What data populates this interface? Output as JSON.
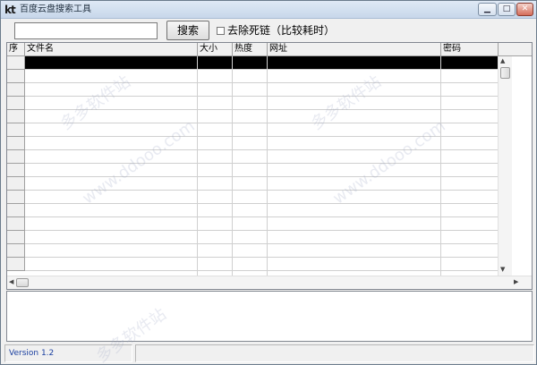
{
  "window": {
    "title": "百度云盘搜索工具",
    "icon": "kt",
    "controls": {
      "minimize_icon": "minimize-icon",
      "maximize_icon": "maximize-icon",
      "close_icon": "close-icon"
    }
  },
  "search": {
    "input_value": "",
    "button_label": "搜索",
    "checkbox_label": "去除死链（比较耗时）",
    "checkbox_checked": false
  },
  "table": {
    "columns": [
      "序",
      "文件名",
      "大小",
      "热度",
      "网址",
      "密码"
    ],
    "row_count": 16,
    "selected_row": 0
  },
  "status": {
    "version": "Version 1.2",
    "message": ""
  },
  "watermarks": [
    "多多软件站",
    "www.ddooo.com",
    "多多软件站",
    "www.ddooo.com",
    "多多软件站"
  ],
  "colors": {
    "accent": "#1a3fa0",
    "selection": "#000000"
  }
}
